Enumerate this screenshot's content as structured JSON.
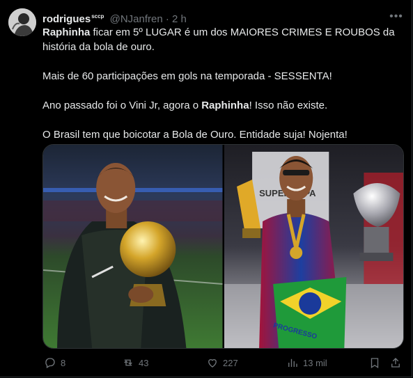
{
  "author": {
    "name": "rodrigues",
    "badge": "sccp",
    "handle": "@NJanfren",
    "separator": "·",
    "time": "2 h"
  },
  "tweet": {
    "line1_bold": "Raphinha",
    "line1_rest": " ficar em 5º LUGAR é um dos MAIORES CRIMES E ROUBOS da história da bola de ouro.",
    "line2": "Mais de 60 participações em gols na temporada - SESSENTA!",
    "line3_start": "Ano passado foi o Vini Jr, agora o ",
    "line3_bold": "Raphinha",
    "line3_end": "! Isso não existe.",
    "line4": "O Brasil tem que boicotar a Bola de Ouro. Entidade suja! Nojenta!"
  },
  "media": {
    "right_banner_text": "SUPERCOPA",
    "flag_text": "PROGRESSO"
  },
  "actions": {
    "replies": "8",
    "retweets": "43",
    "likes": "227",
    "views": "13 mil"
  },
  "icons": [
    "more-icon",
    "reply-icon",
    "retweet-icon",
    "like-icon",
    "views-icon",
    "bookmark-icon",
    "share-icon"
  ],
  "colors": {
    "background": "#000000",
    "text": "#e7e9ea",
    "muted": "#71767b",
    "border": "#2f3336"
  }
}
